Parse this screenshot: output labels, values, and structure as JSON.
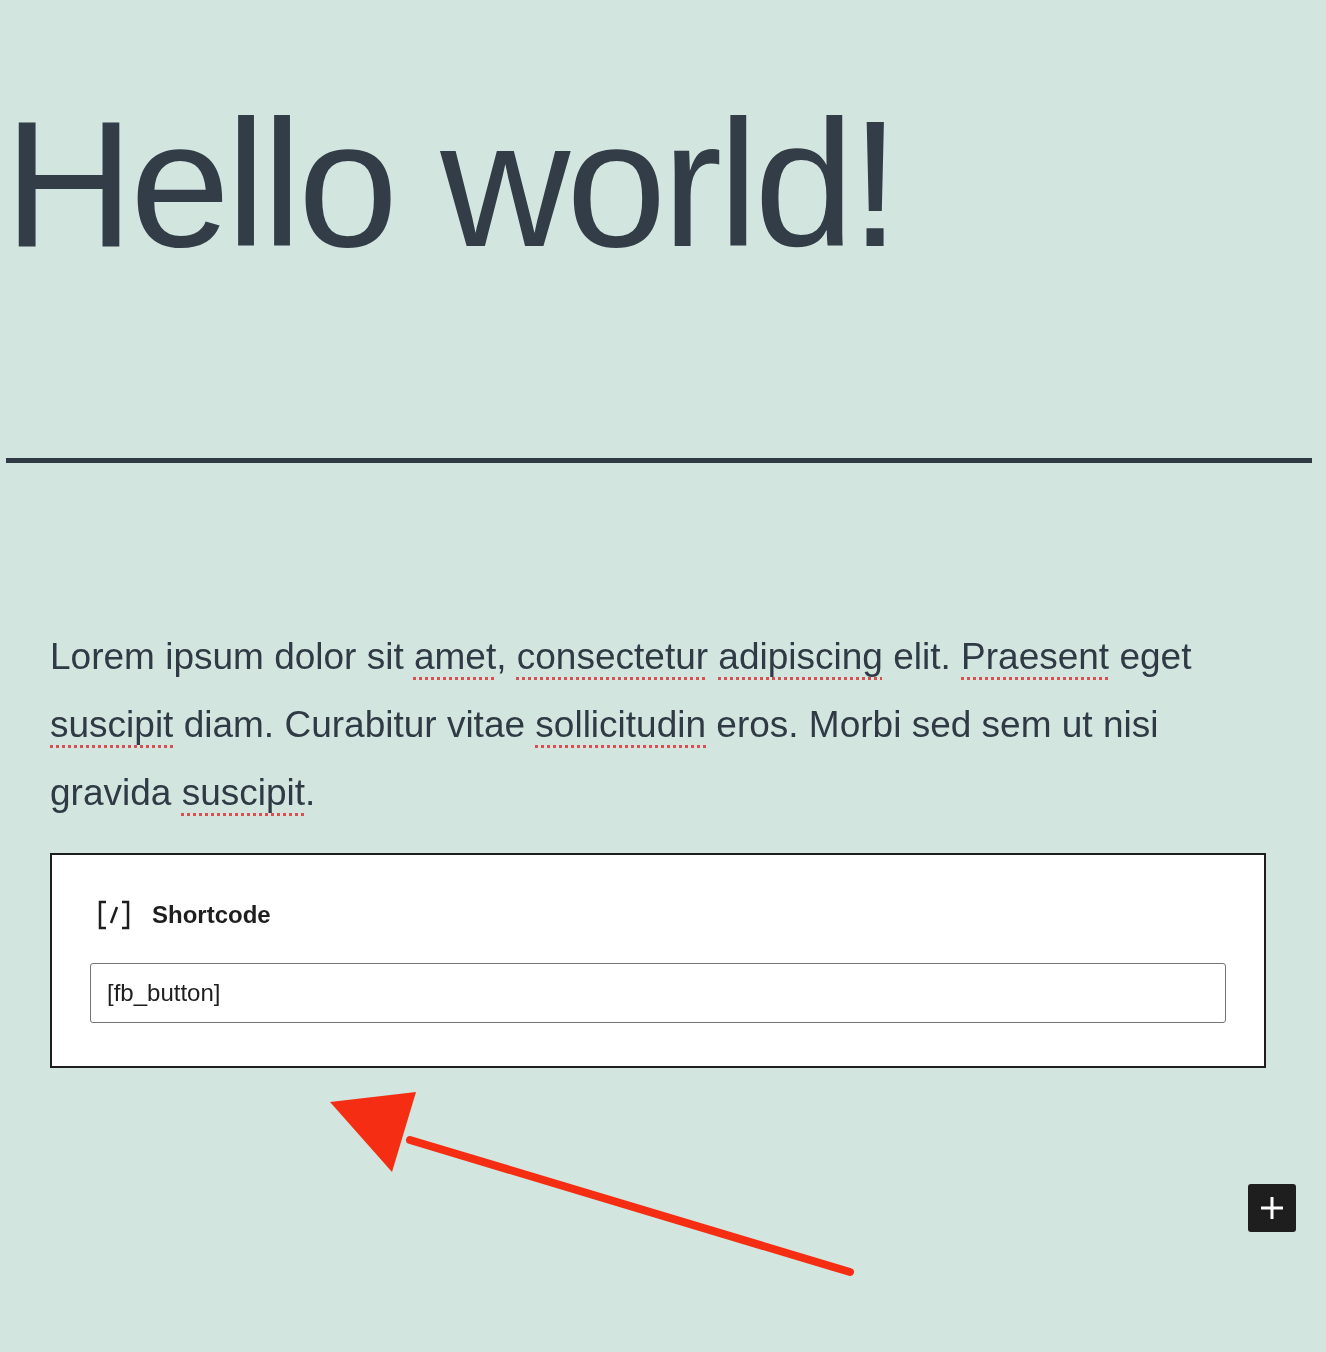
{
  "post_title": "Hello world!",
  "paragraph": {
    "segments": [
      {
        "text": "Lorem ipsum dolor sit",
        "misspelled": false
      },
      {
        "text": "amet",
        "misspelled": true,
        "space_before": true
      },
      {
        "text": ",",
        "misspelled": false
      },
      {
        "text": "consectetur",
        "misspelled": true,
        "space_before": true
      },
      {
        "text": "adipiscing",
        "misspelled": true,
        "space_before": true
      },
      {
        "text": "elit.",
        "misspelled": false,
        "space_before": true
      },
      {
        "text": "Praesent",
        "misspelled": true,
        "space_before": true
      },
      {
        "text": "eget",
        "misspelled": false,
        "space_before": true
      },
      {
        "text": "suscipit",
        "misspelled": true,
        "space_before": true
      },
      {
        "text": "diam. Curabitur vitae",
        "misspelled": false,
        "space_before": true
      },
      {
        "text": "sollicitudin",
        "misspelled": true,
        "space_before": true
      },
      {
        "text": "eros. Morbi sed sem ut nisi gravida",
        "misspelled": false,
        "space_before": true
      },
      {
        "text": "suscipit",
        "misspelled": true,
        "space_before": true
      },
      {
        "text": ".",
        "misspelled": false
      }
    ]
  },
  "shortcode_block": {
    "label": "Shortcode",
    "value": "[fb_button]"
  }
}
